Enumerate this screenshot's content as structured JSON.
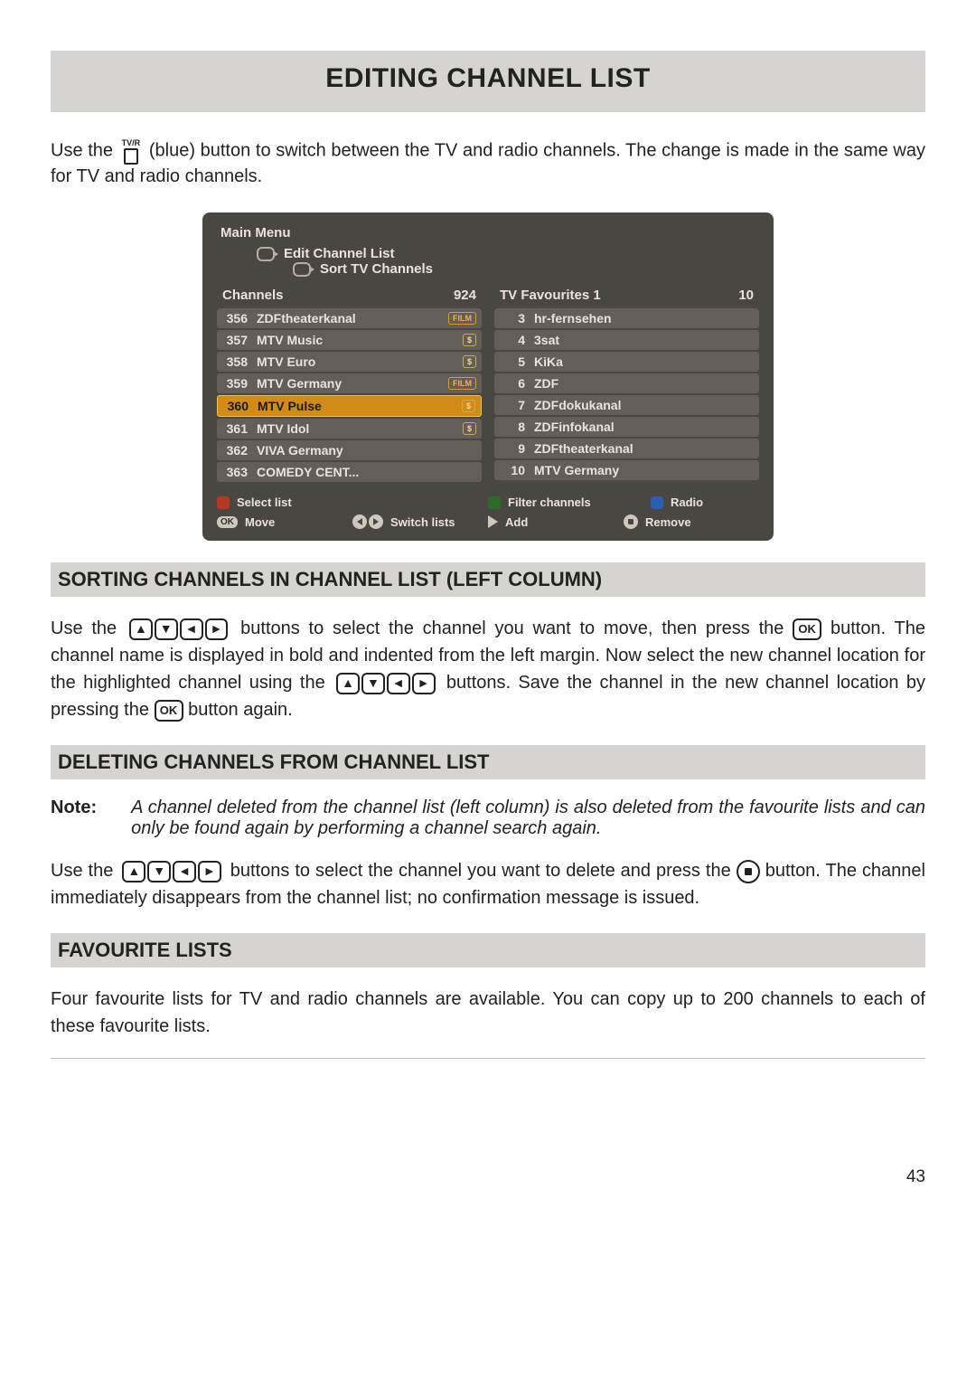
{
  "title": "EDITING CHANNEL LIST",
  "intro_1": "Use the ",
  "intro_2": " (blue) button to switch between the TV and radio channels. The change is made in the same way for TV and radio channels.",
  "tvr_label": "TV/R",
  "osd": {
    "crumb1": "Main Menu",
    "crumb2": "Edit Channel List",
    "crumb3": "Sort TV Channels",
    "left_title": "Channels",
    "left_count": "924",
    "right_title": "TV Favourites 1",
    "right_count": "10",
    "left": [
      {
        "n": "356",
        "name": "ZDFtheaterkanal",
        "tag": "FILM"
      },
      {
        "n": "357",
        "name": "MTV Music",
        "tag": "$"
      },
      {
        "n": "358",
        "name": "MTV Euro",
        "tag": "$"
      },
      {
        "n": "359",
        "name": "MTV Germany",
        "tag": "FILM"
      },
      {
        "n": "360",
        "name": "MTV Pulse",
        "tag": "$",
        "sel": true
      },
      {
        "n": "361",
        "name": "MTV Idol",
        "tag": "$"
      },
      {
        "n": "362",
        "name": "VIVA Germany"
      },
      {
        "n": "363",
        "name": "COMEDY CENT..."
      }
    ],
    "right": [
      {
        "n": "3",
        "name": "hr-fernsehen"
      },
      {
        "n": "4",
        "name": "3sat"
      },
      {
        "n": "5",
        "name": "KiKa"
      },
      {
        "n": "6",
        "name": "ZDF"
      },
      {
        "n": "7",
        "name": "ZDFdokukanal"
      },
      {
        "n": "8",
        "name": "ZDFinfokanal"
      },
      {
        "n": "9",
        "name": "ZDFtheaterkanal"
      },
      {
        "n": "10",
        "name": "MTV Germany"
      }
    ],
    "act_select": "Select list",
    "act_filter": "Filter channels",
    "act_radio": "Radio",
    "act_move": "Move",
    "act_switch": "Switch lists",
    "act_add": "Add",
    "act_remove": "Remove",
    "ok": "OK"
  },
  "section1": "SORTING CHANNELS IN CHANNEL LIST (LEFT COLUMN)",
  "s1_a": "Use the ",
  "s1_b": " buttons to select the channel you want to move, then press the ",
  "s1_c": " button. The channel name is displayed in bold and indented from the left margin. Now select the new channel location for the highlighted channel using the ",
  "s1_d": " buttons. Save the channel in the new channel location by pressing the ",
  "s1_e": " button again.",
  "ok_label": "OK",
  "section2": "DELETING CHANNELS FROM CHANNEL LIST",
  "note_label": "Note:",
  "note_text": "A channel deleted from the channel list (left column) is also deleted from the favourite lists and can only be found again by performing a channel search again.",
  "s2_a": "Use the ",
  "s2_b": " buttons to select the channel you want to delete and press the ",
  "s2_c": " button. The channel immediately disappears from the channel list; no confirmation message is issued.",
  "section3": "FAVOURITE LISTS",
  "s3_text": "Four favourite lists for TV and radio channels are available. You can copy up to 200 channels to each of these favourite lists.",
  "page_number": "43"
}
